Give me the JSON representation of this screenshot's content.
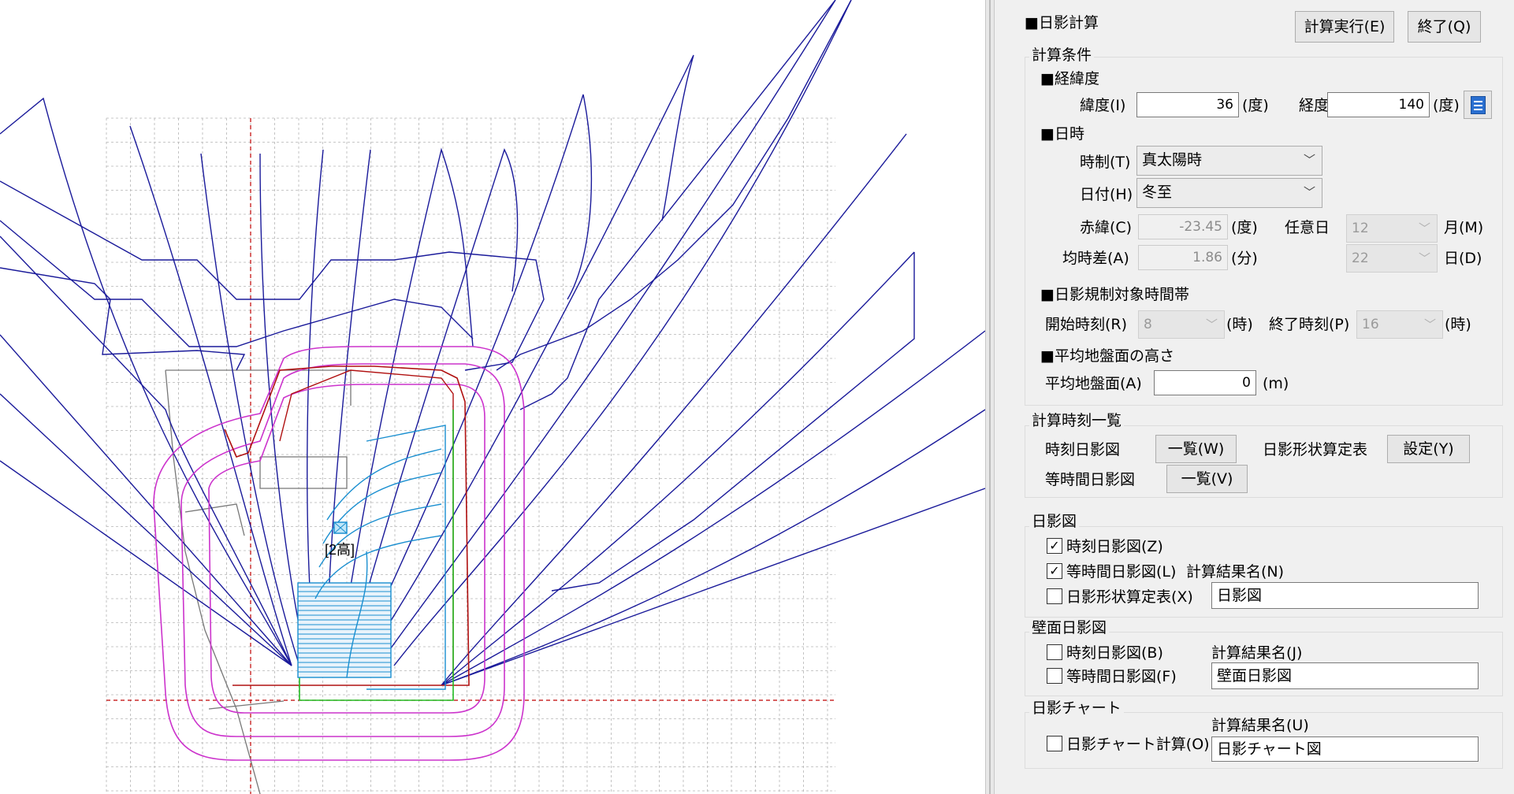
{
  "canvas": {
    "building_label": "[2高]",
    "colors": {
      "grid": "#b5b5b5",
      "axis": "#c00000",
      "shadow_lines": "#1a1a9a",
      "contour_outer": "#cc33cc",
      "contour_inner": "#b01010",
      "building": "#1a8fd0",
      "boundary": "#22bb22"
    }
  },
  "panel": {
    "title": "■日影計算",
    "run_button": "計算実行(E)",
    "exit_button": "終了(Q)",
    "calc_conditions": {
      "legend": "計算条件",
      "latlon_heading": "■経緯度",
      "latitude_label": "緯度(I)",
      "latitude_value": "36",
      "latitude_unit": "(度)",
      "longitude_label": "経度(K)",
      "longitude_value": "140",
      "longitude_unit": "(度)",
      "list_icon": "document-list-icon",
      "datetime_heading": "■日時",
      "time_system_label": "時制(T)",
      "time_system_value": "真太陽時",
      "date_label": "日付(H)",
      "date_value": "冬至",
      "declination_label": "赤緯(C)",
      "declination_value": "-23.45",
      "declination_unit": "(度)",
      "any_day_label": "任意日",
      "month_value": "12",
      "month_unit": "月(M)",
      "eot_label": "均時差(A)",
      "eot_value": "1.86",
      "eot_unit": "(分)",
      "day_value": "22",
      "day_unit": "日(D)",
      "regulated_heading": "■日影規制対象時間帯",
      "start_label": "開始時刻(R)",
      "start_value": "8",
      "start_unit": "(時)",
      "end_label": "終了時刻(P)",
      "end_value": "16",
      "end_unit": "(時)",
      "ground_heading": "■平均地盤面の高さ",
      "ground_label": "平均地盤面(A)",
      "ground_value": "0",
      "ground_unit": "(m)"
    },
    "time_list": {
      "legend": "計算時刻一覧",
      "timed_label": "時刻日影図",
      "timed_button": "一覧(W)",
      "table_label": "日影形状算定表",
      "table_button": "設定(Y)",
      "equal_label": "等時間日影図",
      "equal_button": "一覧(V)"
    },
    "shadow_map": {
      "legend": "日影図",
      "timed_label": "時刻日影図(Z)",
      "timed_checked": true,
      "equal_label": "等時間日影図(L)",
      "equal_checked": true,
      "table_label": "日影形状算定表(X)",
      "table_checked": false,
      "result_name_label": "計算結果名(N)",
      "result_name_value": "日影図"
    },
    "wall_shadow": {
      "legend": "壁面日影図",
      "timed_label": "時刻日影図(B)",
      "timed_checked": false,
      "equal_label": "等時間日影図(F)",
      "equal_checked": false,
      "result_name_label": "計算結果名(J)",
      "result_name_value": "壁面日影図"
    },
    "shadow_chart": {
      "legend": "日影チャート",
      "calc_label": "日影チャート計算(O)",
      "calc_checked": false,
      "result_name_label": "計算結果名(U)",
      "result_name_value": "日影チャート図"
    }
  }
}
